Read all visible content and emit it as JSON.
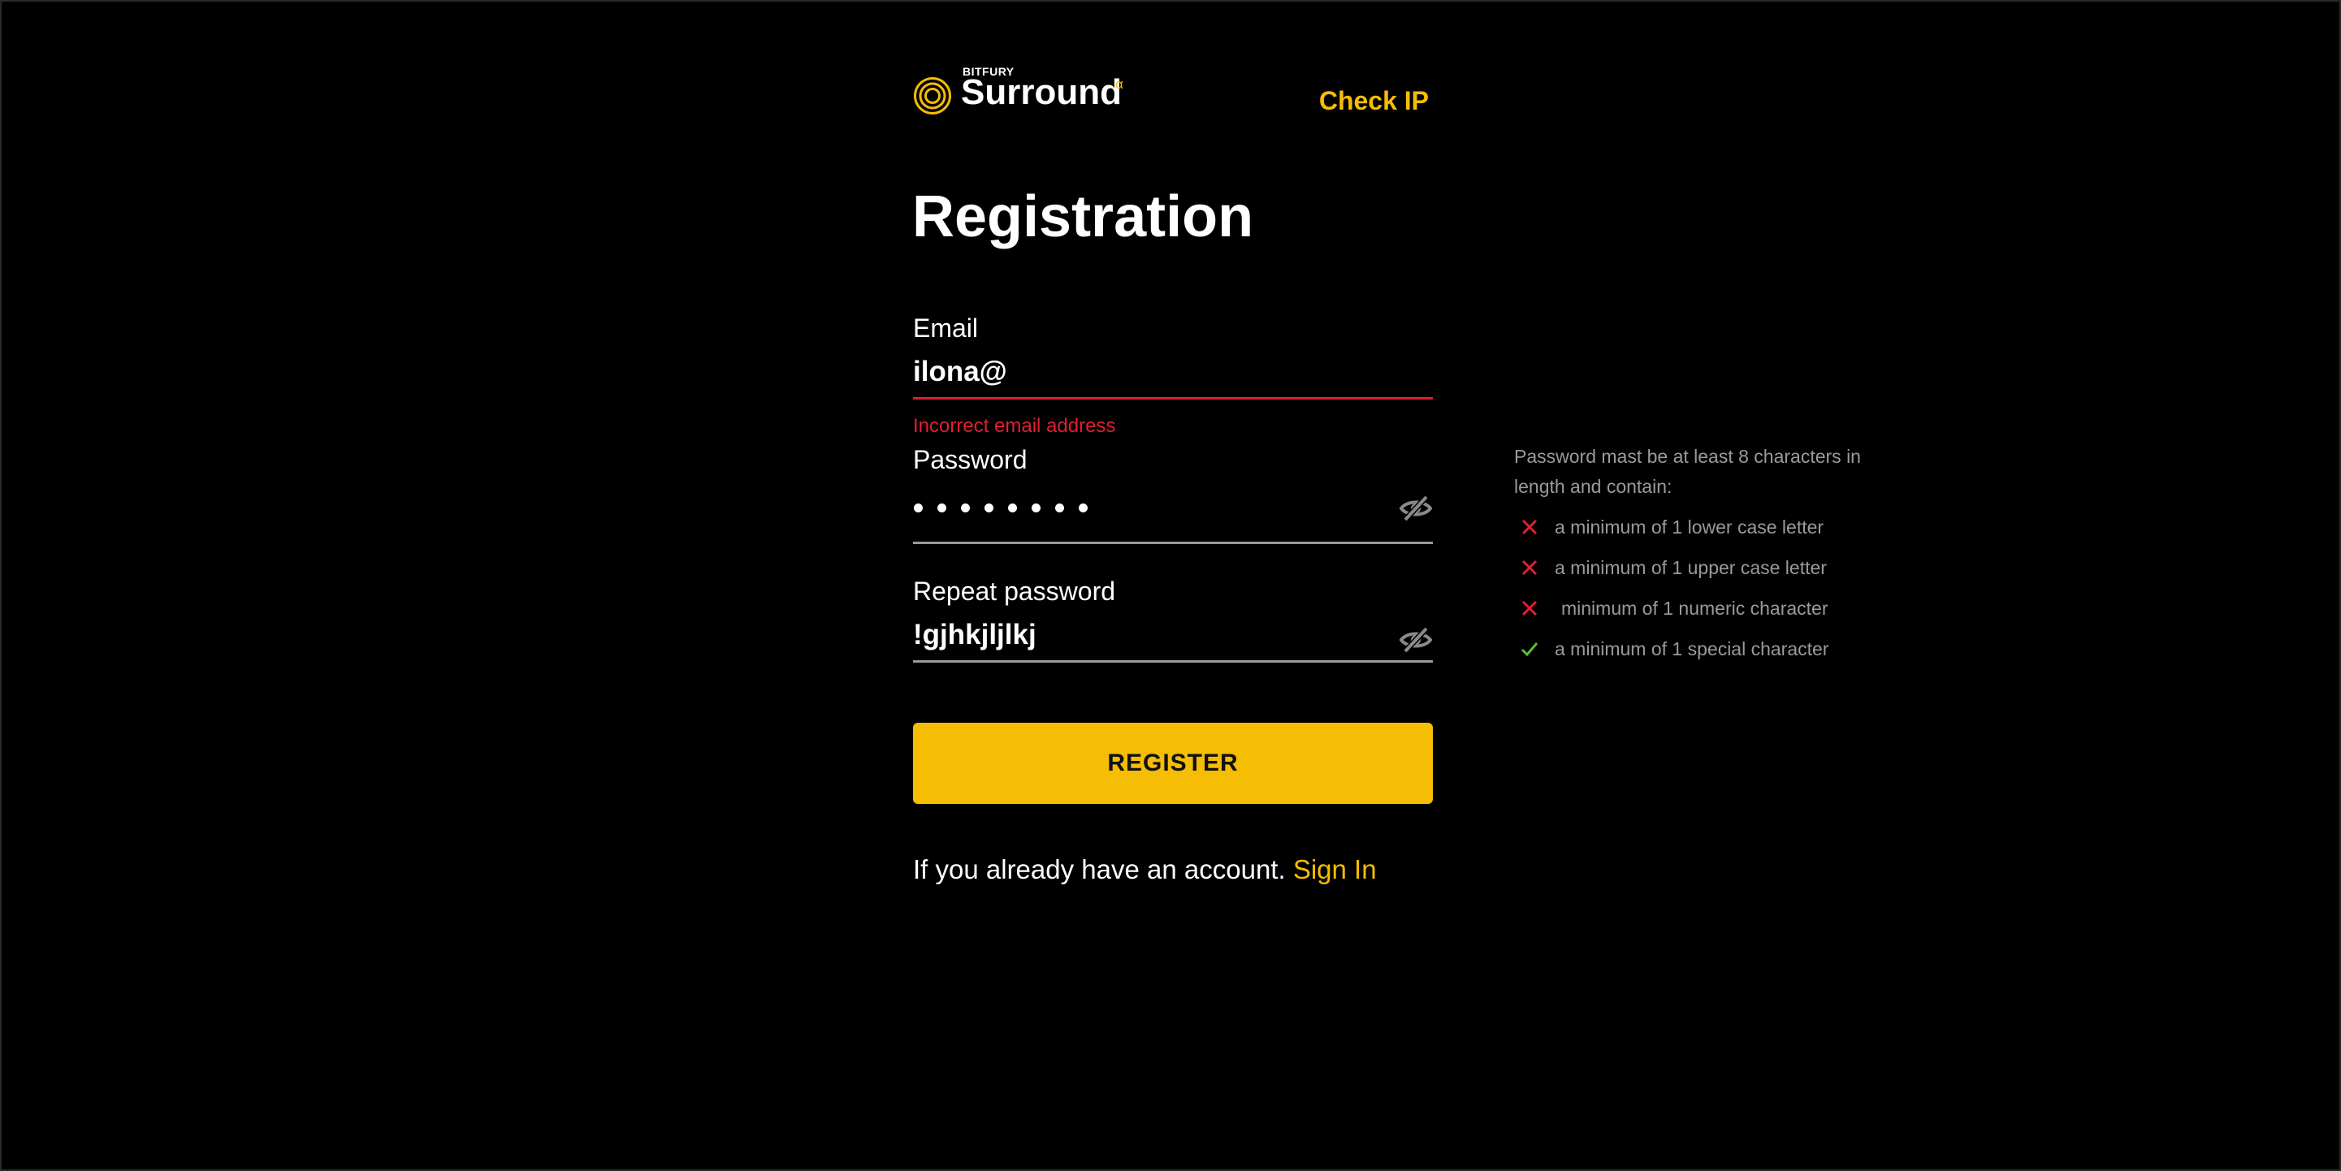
{
  "header": {
    "brand_small": "BITFURY",
    "brand_name": "Surround",
    "brand_badge": "α",
    "check_ip_label": "Check IP"
  },
  "page": {
    "title": "Registration"
  },
  "form": {
    "email": {
      "label": "Email",
      "value": "ilona@",
      "error": "Incorrect email address"
    },
    "password": {
      "label": "Password",
      "masked_length": 8
    },
    "repeat_password": {
      "label": "Repeat password",
      "value": "!gjhkjljlkj"
    },
    "submit_label": "REGISTER",
    "signin_prompt": "If you already have an account.",
    "signin_link": "Sign In"
  },
  "requirements": {
    "intro": "Password mast be at least 8 characters in length and contain:",
    "items": [
      {
        "text": "a minimum of 1 lower case letter",
        "met": false
      },
      {
        "text": "a minimum of 1 upper case letter",
        "met": false
      },
      {
        "text": "minimum of 1 numeric character",
        "met": false
      },
      {
        "text": "a minimum of 1 special character",
        "met": true
      }
    ]
  },
  "colors": {
    "accent": "#F5BD04",
    "error": "#E11F31",
    "success": "#5DBB2F",
    "muted": "#9a9a9a",
    "background": "#000000"
  },
  "icons": {
    "logo": "concentric-rings-icon",
    "password_toggle": "eye-off-icon",
    "requirement_unmet": "cross-icon",
    "requirement_met": "check-icon"
  }
}
